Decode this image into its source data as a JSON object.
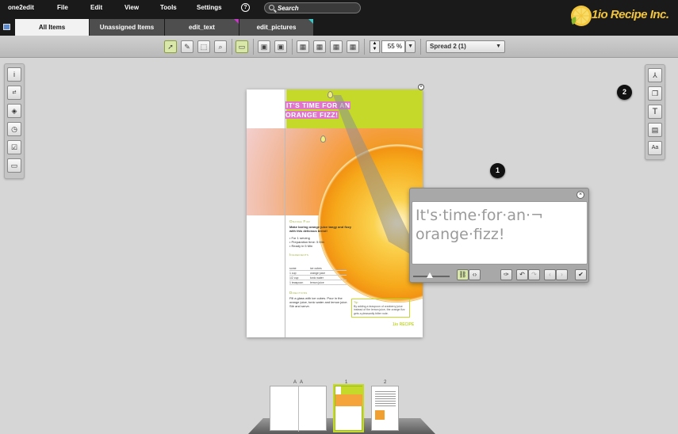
{
  "menubar": {
    "app": "one2edit",
    "items": [
      "File",
      "Edit",
      "View",
      "Tools",
      "Settings"
    ],
    "help": "?",
    "search_placeholder": "Search"
  },
  "logo": {
    "text": "1io Recipe Inc."
  },
  "tabs": [
    {
      "label": "All Items",
      "active": true
    },
    {
      "label": "Unassigned Items",
      "active": false
    },
    {
      "label": "edit_text",
      "active": false,
      "corner_color": "#c838c8"
    },
    {
      "label": "edit_pictures",
      "active": false,
      "corner_color": "#38c8c8"
    }
  ],
  "toolbar": {
    "zoom": "55 %",
    "spread": "Spread 2 (1)"
  },
  "badges": {
    "one": "1",
    "two": "2"
  },
  "document": {
    "headline": "It's time for an orange fizz!",
    "recipe_title": "Orange Fizz",
    "intro": "Make boring orange juice tangy and fizzy with this delicious blend!",
    "bullets": [
      "• For 1 serving",
      "• Preparation time: 5 Min",
      "• Ready in 5 Min"
    ],
    "ingredients_title": "Ingredients",
    "ingredients": [
      [
        "some",
        "ice cubes"
      ],
      [
        "1 cup",
        "orange juice"
      ],
      [
        "1/2 cup",
        "tonic water"
      ],
      [
        "1 teaspoon",
        "lemon juice"
      ]
    ],
    "directions_title": "Directions",
    "directions": "Fill a glass with ice cubes. Pour in the orange juice, tonic water and lemon juice. Stir and serve.",
    "tip_title": "Tip:",
    "tip": "By adding a teaspoon of cranberry juice instead of the lemon juice, the orange fizz gets a pleasantly bitter note.",
    "mini_logo": "1io RECIPE"
  },
  "editor": {
    "text_line1": "It's·time·for·an·¬",
    "text_line2": "orange·fizz!"
  },
  "pager": {
    "labels": [
      "A",
      "A",
      "1",
      "2"
    ]
  },
  "colors": {
    "accent_green": "#c4d92a",
    "highlight_pink": "#e274cc",
    "logo_yellow": "#f3c53a"
  }
}
